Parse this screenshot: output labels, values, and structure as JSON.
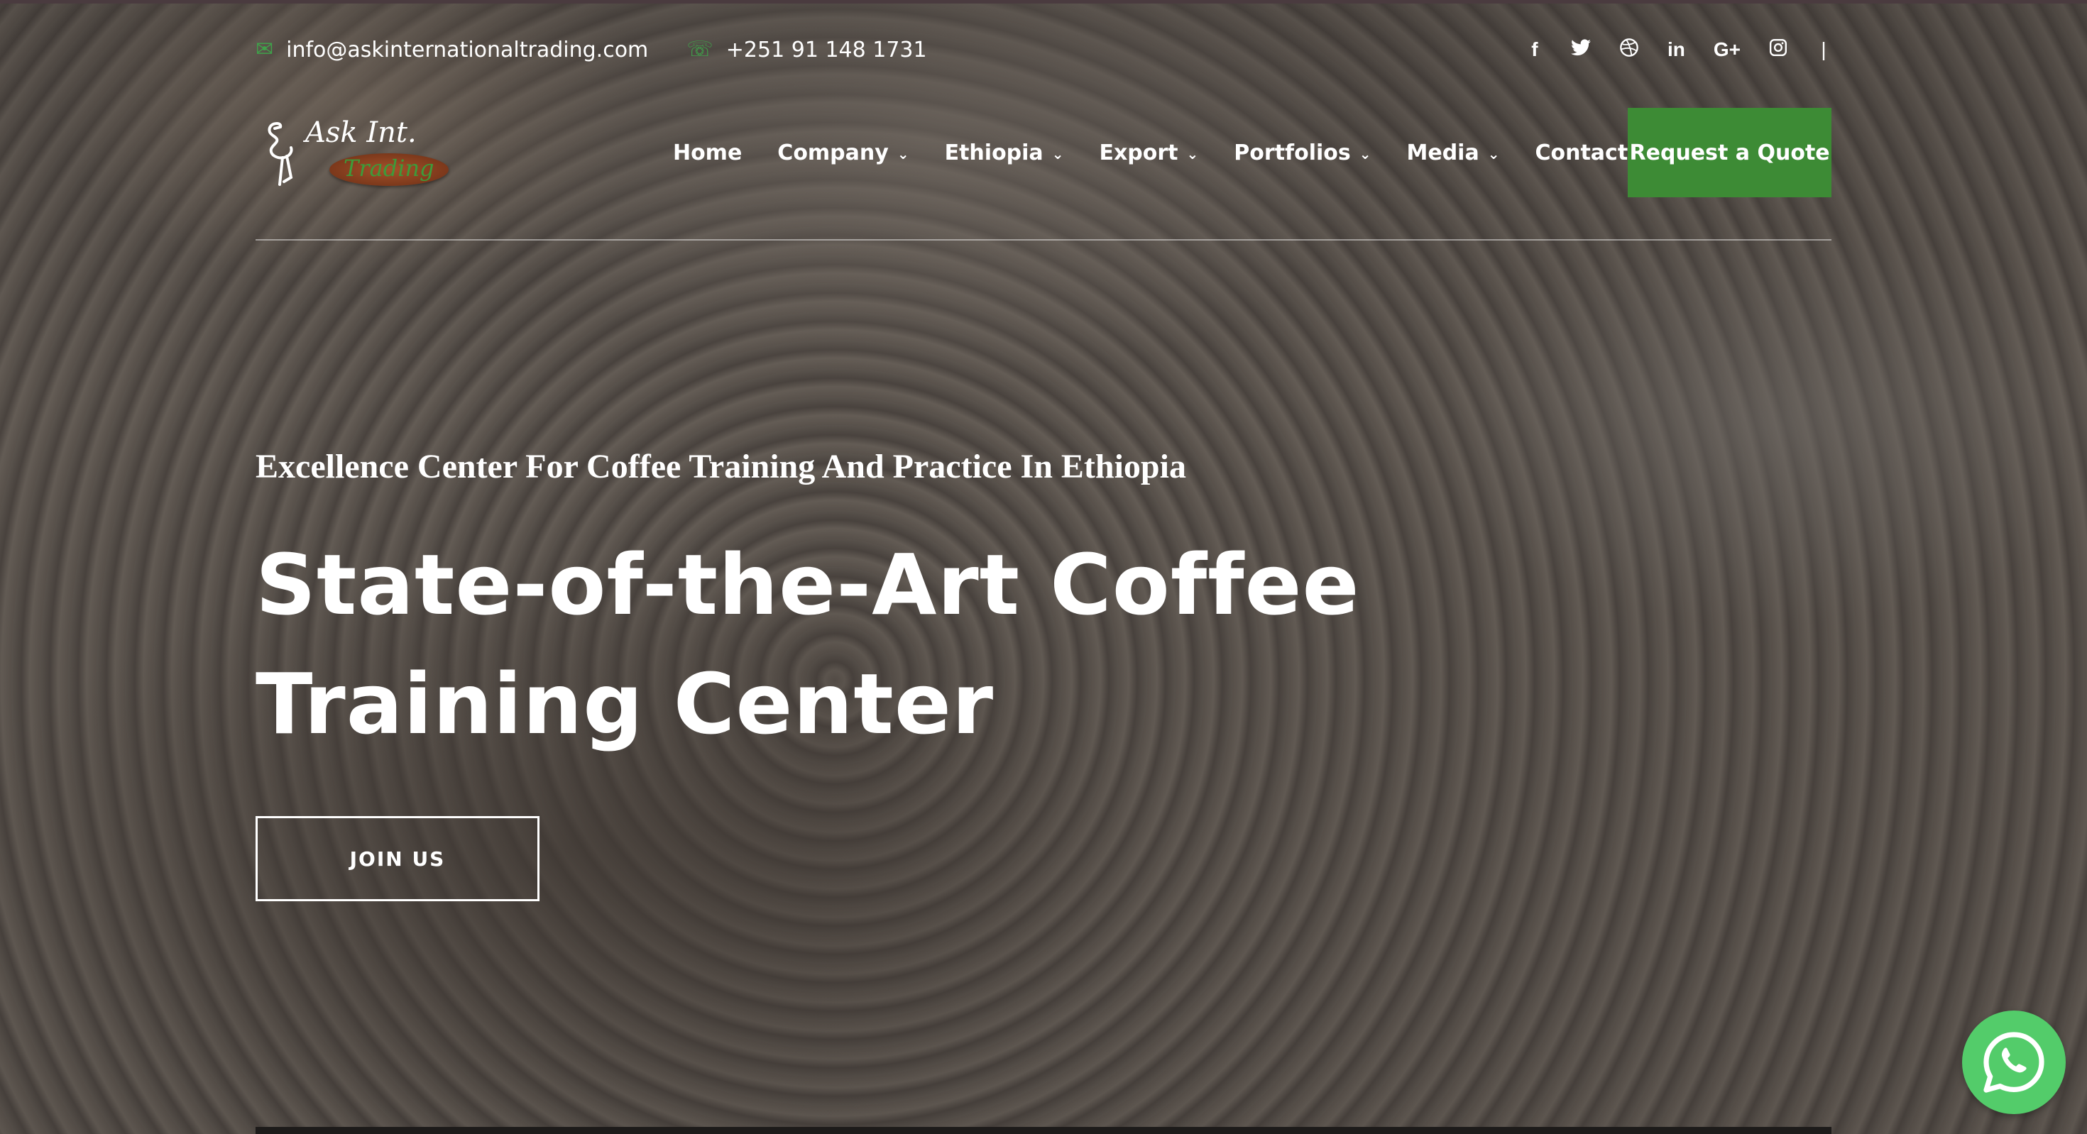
{
  "topbar": {
    "email": "info@askinternationaltrading.com",
    "phone": "+251 91 148 1731",
    "social": [
      "f",
      "t",
      "dribbble",
      "in",
      "G+",
      "instagram",
      "|"
    ]
  },
  "logo": {
    "brand": "Ask Int.",
    "tagline": "Trading"
  },
  "nav": {
    "items": [
      {
        "label": "Home",
        "has_dropdown": false
      },
      {
        "label": "Company",
        "has_dropdown": true
      },
      {
        "label": "Ethiopia",
        "has_dropdown": true
      },
      {
        "label": "Export",
        "has_dropdown": true
      },
      {
        "label": "Portfolios",
        "has_dropdown": true
      },
      {
        "label": "Media",
        "has_dropdown": true
      },
      {
        "label": "Contact",
        "has_dropdown": false
      }
    ],
    "cta": "Request a Quote"
  },
  "hero": {
    "subtitle": "Excellence Center For Coffee Training And Practice In Ethiopia",
    "headline_line1": "State-of-the-Art Coffee",
    "headline_line2": "Training Center",
    "button": "JOIN US"
  },
  "colors": {
    "accent": "#3d8b35",
    "whatsapp": "#53cc6a"
  }
}
